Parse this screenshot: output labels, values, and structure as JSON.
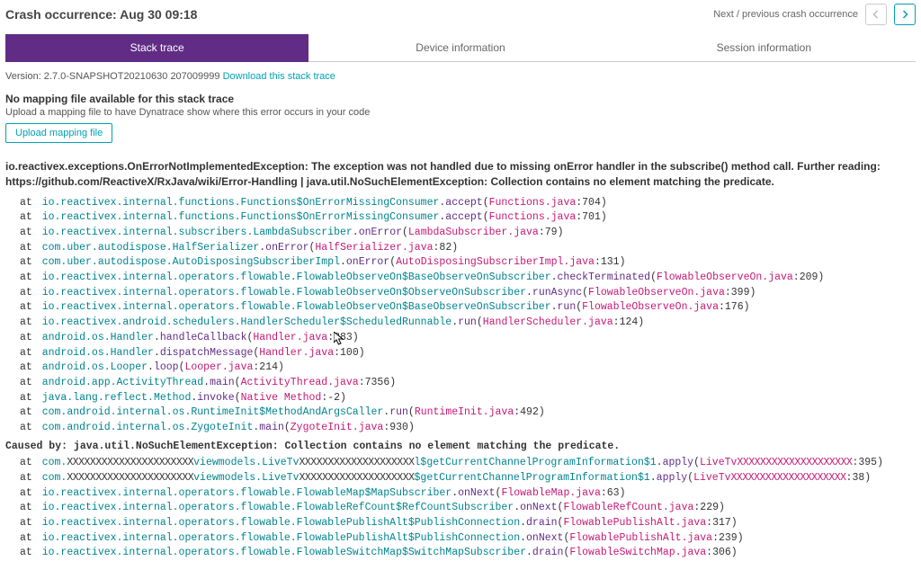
{
  "header": {
    "title": "Crash occurrence: Aug 30 09:18",
    "nav_label": "Next / previous crash occurrence"
  },
  "tabs": [
    {
      "label": "Stack trace",
      "active": true
    },
    {
      "label": "Device information",
      "active": false
    },
    {
      "label": "Session information",
      "active": false
    }
  ],
  "version": {
    "prefix": "Version: 2.7.0-SNAPSHOT20210630 207009999",
    "download_link": "Download this stack trace"
  },
  "mapping": {
    "heading": "No mapping file available for this stack trace",
    "help": "Upload a mapping file to have Dynatrace show where this error occurs in your code",
    "button": "Upload mapping file"
  },
  "exception": "io.reactivex.exceptions.OnErrorNotImplementedException: The exception was not handled due to missing onError handler in the subscribe() method call. Further reading: https://github.com/ReactiveX/RxJava/wiki/Error-Handling | java.util.NoSuchElementException: Collection contains no element matching the predicate.",
  "trace": [
    {
      "pkg": "io.reactivex.internal.functions.Functions$OnErrorMissingConsumer",
      "method": "accept",
      "file": "Functions.java",
      "line": "704"
    },
    {
      "pkg": "io.reactivex.internal.functions.Functions$OnErrorMissingConsumer",
      "method": "accept",
      "file": "Functions.java",
      "line": "701"
    },
    {
      "pkg": "io.reactivex.internal.subscribers.LambdaSubscriber",
      "method": "onError",
      "file": "LambdaSubscriber.java",
      "line": "79"
    },
    {
      "pkg": "com.uber.autodispose.HalfSerializer",
      "method": "onError",
      "file": "HalfSerializer.java",
      "line": "82"
    },
    {
      "pkg": "com.uber.autodispose.AutoDisposingSubscriberImpl",
      "method": "onError",
      "file": "AutoDisposingSubscriberImpl.java",
      "line": "131"
    },
    {
      "pkg": "io.reactivex.internal.operators.flowable.FlowableObserveOn$BaseObserveOnSubscriber",
      "method": "checkTerminated",
      "file": "FlowableObserveOn.java",
      "line": "209"
    },
    {
      "pkg": "io.reactivex.internal.operators.flowable.FlowableObserveOn$ObserveOnSubscriber",
      "method": "runAsync",
      "file": "FlowableObserveOn.java",
      "line": "399"
    },
    {
      "pkg": "io.reactivex.internal.operators.flowable.FlowableObserveOn$BaseObserveOnSubscriber",
      "method": "run",
      "file": "FlowableObserveOn.java",
      "line": "176"
    },
    {
      "pkg": "io.reactivex.android.schedulers.HandlerScheduler$ScheduledRunnable",
      "method": "run",
      "file": "HandlerScheduler.java",
      "line": "124"
    },
    {
      "pkg": "android.os.Handler",
      "method": "handleCallback",
      "file": "Handler.java",
      "line": "883"
    },
    {
      "pkg": "android.os.Handler",
      "method": "dispatchMessage",
      "file": "Handler.java",
      "line": "100"
    },
    {
      "pkg": "android.os.Looper",
      "method": "loop",
      "file": "Looper.java",
      "line": "214"
    },
    {
      "pkg": "android.app.ActivityThread",
      "method": "main",
      "file": "ActivityThread.java",
      "line": "7356"
    },
    {
      "pkg": "java.lang.reflect.Method",
      "method": "invoke",
      "file": "Native Method",
      "line": "-2"
    },
    {
      "pkg": "com.android.internal.os.RuntimeInit$MethodAndArgsCaller",
      "method": "run",
      "file": "RuntimeInit.java",
      "line": "492"
    },
    {
      "pkg": "com.android.internal.os.ZygoteInit",
      "method": "main",
      "file": "ZygoteInit.java",
      "line": "930"
    }
  ],
  "caused_by": "Caused by: java.util.NoSuchElementException: Collection contains no element matching the predicate.",
  "trace2": [
    {
      "pkg": "com.",
      "obf1": "XXXXXXXXXXXXXXXXXXXXXX",
      "mid": "viewmodels.LiveTv",
      "obf2": "XXXXXXXXXXXXXXXXXXXX",
      "mid2": "l$getCurrentChannelProgramInformation$1",
      "method": "apply",
      "file_prefix": "LiveTv",
      "file_obf": "XXXXXXXXXXXXXXXXXXXX",
      "line": "395"
    },
    {
      "pkg": "com.",
      "obf1": "XXXXXXXXXXXXXXXXXXXXXX",
      "mid": "viewmodels.LiveTv",
      "obf2": "XXXXXXXXXXXXXXXXXXXX",
      "mid2": "$getCurrentChannelProgramInformation$1",
      "method": "apply",
      "file_prefix": "LiveTv",
      "file_obf": "XXXXXXXXXXXXXXXXXXXX",
      "line": "38"
    },
    {
      "pkg": "io.reactivex.internal.operators.flowable.FlowableMap$MapSubscriber",
      "method": "onNext",
      "file": "FlowableMap.java",
      "line": "63"
    },
    {
      "pkg": "io.reactivex.internal.operators.flowable.FlowableRefCount$RefCountSubscriber",
      "method": "onNext",
      "file": "FlowableRefCount.java",
      "line": "229"
    },
    {
      "pkg": "io.reactivex.internal.operators.flowable.FlowablePublishAlt$PublishConnection",
      "method": "drain",
      "file": "FlowablePublishAlt.java",
      "line": "317"
    },
    {
      "pkg": "io.reactivex.internal.operators.flowable.FlowablePublishAlt$PublishConnection",
      "method": "onNext",
      "file": "FlowablePublishAlt.java",
      "line": "239"
    },
    {
      "pkg": "io.reactivex.internal.operators.flowable.FlowableSwitchMap$SwitchMapSubscriber",
      "method": "drain",
      "file": "FlowableSwitchMap.java",
      "line": "306"
    }
  ]
}
